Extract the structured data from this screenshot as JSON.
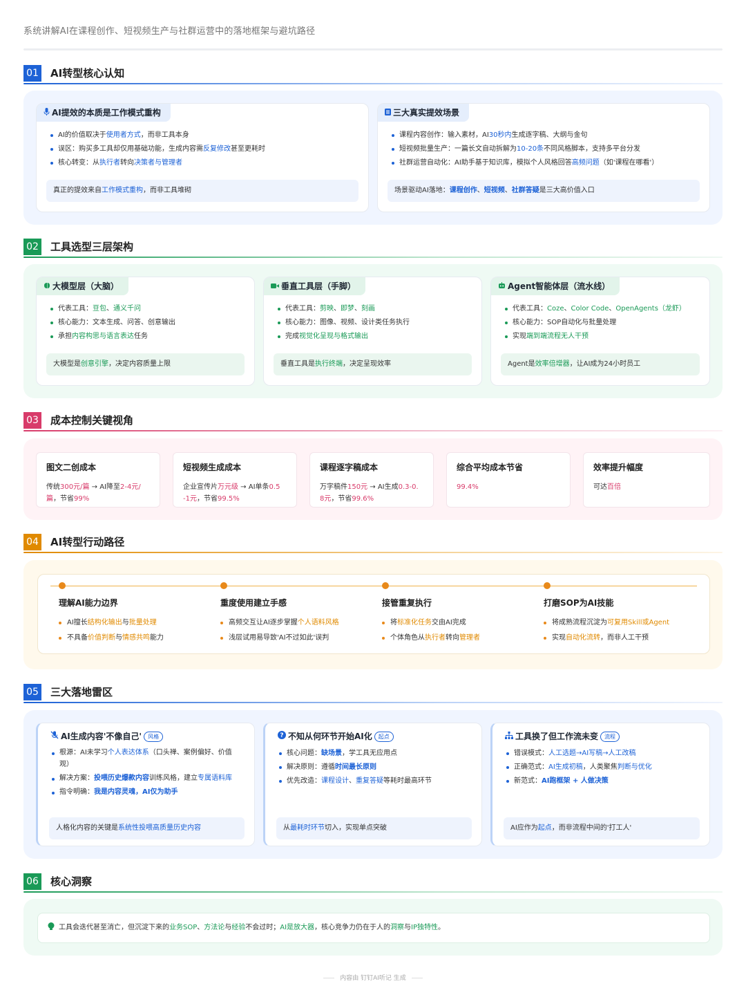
{
  "page_title": "系统讲解AI在课程创作、短视频生产与社群运营中的落地框架与避坑路径",
  "colors": {
    "blue": "#1d62d6",
    "green": "#1a9a57",
    "rose": "#d83b6a",
    "amber": "#e08a00"
  },
  "sections": {
    "s1": {
      "num": "01",
      "title": "AI转型核心认知",
      "cards": [
        {
          "icon": "microphone-icon",
          "heading": "AI提效的本质是工作模式重构",
          "points": [
            [
              {
                "t": "AI的价值取决于"
              },
              {
                "t": "使用者方式",
                "h": "blue"
              },
              {
                "t": "，而非工具本身"
              }
            ],
            [
              {
                "t": "误区：购买多工具却仅用基础功能，生成内容需"
              },
              {
                "t": "反复修改",
                "h": "blue"
              },
              {
                "t": "甚至更耗时"
              }
            ],
            [
              {
                "t": "核心转变：从"
              },
              {
                "t": "执行者",
                "h": "blue"
              },
              {
                "t": "转向"
              },
              {
                "t": "决策者与管理者",
                "h": "blue"
              }
            ]
          ],
          "note": [
            {
              "t": "真正的提效来自"
            },
            {
              "t": "工作模式重构",
              "h": "blue"
            },
            {
              "t": "，而非工具堆砌"
            }
          ]
        },
        {
          "icon": "list-icon",
          "heading": "三大真实提效场景",
          "points": [
            [
              {
                "t": "课程内容创作：输入素材，AI"
              },
              {
                "t": "30秒内",
                "h": "blue"
              },
              {
                "t": "生成逐字稿、大纲与金句"
              }
            ],
            [
              {
                "t": "短视频批量生产：一篇长文自动拆解为"
              },
              {
                "t": "10-20条",
                "h": "blue"
              },
              {
                "t": "不同风格脚本，支持多平台分发"
              }
            ],
            [
              {
                "t": "社群运营自动化：AI助手基于知识库，模拟个人风格回答"
              },
              {
                "t": "高频问题",
                "h": "blue"
              },
              {
                "t": "（如'课程在哪看'）"
              }
            ]
          ],
          "note": [
            {
              "t": "场景驱动AI落地："
            },
            {
              "t": "课程创作",
              "h": "blue",
              "b": true
            },
            {
              "t": "、"
            },
            {
              "t": "短视频",
              "h": "blue",
              "b": true
            },
            {
              "t": "、"
            },
            {
              "t": "社群答疑",
              "h": "blue",
              "b": true
            },
            {
              "t": "是三大高价值入口"
            }
          ]
        }
      ]
    },
    "s2": {
      "num": "02",
      "title": "工具选型三层架构",
      "cards": [
        {
          "icon": "brain-icon",
          "heading": "大模型层（大脑）",
          "points": [
            [
              {
                "t": "代表工具："
              },
              {
                "t": "豆包",
                "h": "green"
              },
              {
                "t": "、"
              },
              {
                "t": "通义千问",
                "h": "green"
              }
            ],
            [
              {
                "t": "核心能力：文本生成、问答、创意输出"
              }
            ],
            [
              {
                "t": "承担"
              },
              {
                "t": "内容构思与语言表达",
                "h": "green"
              },
              {
                "t": "任务"
              }
            ]
          ],
          "note": [
            {
              "t": "大模型是"
            },
            {
              "t": "创意引擎",
              "h": "green"
            },
            {
              "t": "，决定内容质量上限"
            }
          ]
        },
        {
          "icon": "video-camera-icon",
          "heading": "垂直工具层（手脚）",
          "points": [
            [
              {
                "t": "代表工具："
              },
              {
                "t": "剪映",
                "h": "green"
              },
              {
                "t": "、"
              },
              {
                "t": "即梦",
                "h": "green"
              },
              {
                "t": "、"
              },
              {
                "t": "刻画",
                "h": "green"
              }
            ],
            [
              {
                "t": "核心能力：图像、视频、设计类任务执行"
              }
            ],
            [
              {
                "t": "完成"
              },
              {
                "t": "视觉化呈现与格式输出",
                "h": "green"
              }
            ]
          ],
          "note": [
            {
              "t": "垂直工具是"
            },
            {
              "t": "执行终端",
              "h": "green"
            },
            {
              "t": "，决定呈现效率"
            }
          ]
        },
        {
          "icon": "robot-icon",
          "heading": "Agent智能体层（流水线）",
          "points": [
            [
              {
                "t": "代表工具："
              },
              {
                "t": "Coze",
                "h": "green"
              },
              {
                "t": "、"
              },
              {
                "t": "Color Code",
                "h": "green"
              },
              {
                "t": "、"
              },
              {
                "t": "OpenAgents（龙虾）",
                "h": "green"
              }
            ],
            [
              {
                "t": "核心能力：SOP自动化与批量处理"
              }
            ],
            [
              {
                "t": "实现"
              },
              {
                "t": "端到端流程无人干预",
                "h": "green"
              }
            ]
          ],
          "note": [
            {
              "t": "Agent是"
            },
            {
              "t": "效率倍增器",
              "h": "green"
            },
            {
              "t": "，让AI成为24小时员工"
            }
          ]
        }
      ]
    },
    "s3": {
      "num": "03",
      "title": "成本控制关键视角",
      "cards": [
        {
          "heading": "图文二创成本",
          "lines": [
            [
              {
                "t": "传统"
              },
              {
                "t": "300元/篇",
                "h": "rose"
              },
              {
                "t": " → AI降至"
              },
              {
                "t": "2-4元/",
                "h": "rose"
              }
            ],
            [
              {
                "t": "篇",
                "h": "rose"
              },
              {
                "t": "，节省"
              },
              {
                "t": "99%",
                "h": "rose"
              }
            ]
          ]
        },
        {
          "heading": "短视频生成成本",
          "lines": [
            [
              {
                "t": "企业宣传片"
              },
              {
                "t": "万元级",
                "h": "rose"
              },
              {
                "t": " → AI单条"
              },
              {
                "t": "0.5",
                "h": "rose"
              }
            ],
            [
              {
                "t": "-1元",
                "h": "rose"
              },
              {
                "t": "，节省"
              },
              {
                "t": "99.5%",
                "h": "rose"
              }
            ]
          ]
        },
        {
          "heading": "课程逐字稿成本",
          "lines": [
            [
              {
                "t": "万字稿件"
              },
              {
                "t": "150元",
                "h": "rose"
              },
              {
                "t": " → AI生成"
              },
              {
                "t": "0.3-0.",
                "h": "rose"
              }
            ],
            [
              {
                "t": "8元",
                "h": "rose"
              },
              {
                "t": "，节省"
              },
              {
                "t": "99.6%",
                "h": "rose"
              }
            ]
          ]
        },
        {
          "heading": "综合平均成本节省",
          "lines": [
            [
              {
                "t": "99.4%",
                "h": "rose"
              }
            ]
          ]
        },
        {
          "heading": "效率提升幅度",
          "lines": [
            [
              {
                "t": "可达"
              },
              {
                "t": "百倍",
                "h": "rose"
              }
            ]
          ]
        }
      ]
    },
    "s4": {
      "num": "04",
      "title": "AI转型行动路径",
      "steps": [
        {
          "heading": "理解AI能力边界",
          "points": [
            [
              {
                "t": "AI擅长"
              },
              {
                "t": "结构化输出",
                "h": "amber"
              },
              {
                "t": "与"
              },
              {
                "t": "批量处理",
                "h": "amber"
              }
            ],
            [
              {
                "t": "不具备"
              },
              {
                "t": "价值判断",
                "h": "amber"
              },
              {
                "t": "与"
              },
              {
                "t": "情感共鸣",
                "h": "amber"
              },
              {
                "t": "能力"
              }
            ]
          ]
        },
        {
          "heading": "重度使用建立手感",
          "points": [
            [
              {
                "t": "高频交互让AI逐步掌握"
              },
              {
                "t": "个人语料风格",
                "h": "amber"
              }
            ],
            [
              {
                "t": "浅层试用易导致'AI不过如此'误判"
              }
            ]
          ]
        },
        {
          "heading": "接管重复执行",
          "points": [
            [
              {
                "t": "将"
              },
              {
                "t": "标准化任务",
                "h": "amber"
              },
              {
                "t": "交由AI完成"
              }
            ],
            [
              {
                "t": "个体角色从"
              },
              {
                "t": "执行者",
                "h": "amber"
              },
              {
                "t": "转向"
              },
              {
                "t": "管理者",
                "h": "amber"
              }
            ]
          ]
        },
        {
          "heading": "打磨SOP为AI技能",
          "points": [
            [
              {
                "t": "将成熟流程沉淀为"
              },
              {
                "t": "可复用Skill或Agent",
                "h": "amber"
              }
            ],
            [
              {
                "t": "实现"
              },
              {
                "t": "自动化流转",
                "h": "amber"
              },
              {
                "t": "，而非人工干预"
              }
            ]
          ]
        }
      ]
    },
    "s5": {
      "num": "05",
      "title": "三大落地雷区",
      "cards": [
        {
          "icon": "mic-off-icon",
          "heading": "AI生成内容'不像自己'",
          "tag": "风格",
          "points": [
            [
              {
                "t": "根源：AI未学习"
              },
              {
                "t": "个人表达体系",
                "h": "blue"
              },
              {
                "t": "（口头禅、案例偏好、价值观）"
              }
            ],
            [
              {
                "t": "解决方案："
              },
              {
                "t": "投喂历史爆款内容",
                "h": "blue",
                "b": true
              },
              {
                "t": "训练风格，建立"
              },
              {
                "t": "专属语料库",
                "h": "blue"
              }
            ],
            [
              {
                "t": "指令明确："
              },
              {
                "t": "我是内容灵魂，AI仅为助手",
                "h": "blue",
                "b": true
              }
            ]
          ],
          "note": [
            {
              "t": "人格化内容的关键是"
            },
            {
              "t": "系统性投喂高质量历史内容",
              "h": "blue"
            }
          ]
        },
        {
          "icon": "question-circle-icon",
          "heading": "不知从何环节开始AI化",
          "tag": "起点",
          "points": [
            [
              {
                "t": "核心问题："
              },
              {
                "t": "缺场景",
                "h": "blue",
                "b": true
              },
              {
                "t": "，学工具无应用点"
              }
            ],
            [
              {
                "t": "解决原则：遵循"
              },
              {
                "t": "时间最长原则",
                "h": "blue",
                "b": true
              }
            ],
            [
              {
                "t": "优先改造："
              },
              {
                "t": "课程设计",
                "h": "blue"
              },
              {
                "t": "、"
              },
              {
                "t": "重复答疑",
                "h": "blue"
              },
              {
                "t": "等耗时最高环节"
              }
            ]
          ],
          "note": [
            {
              "t": "从"
            },
            {
              "t": "最耗时环节",
              "h": "blue"
            },
            {
              "t": "切入，实现单点突破"
            }
          ]
        },
        {
          "icon": "hierarchy-icon",
          "heading": "工具换了但工作流未变",
          "tag": "流程",
          "points": [
            [
              {
                "t": "错误模式："
              },
              {
                "t": "人工选题→AI写稿→人工改稿",
                "h": "blue"
              }
            ],
            [
              {
                "t": "正确范式："
              },
              {
                "t": "AI生成初稿",
                "h": "blue"
              },
              {
                "t": "，人类聚焦"
              },
              {
                "t": "判断与优化",
                "h": "blue"
              }
            ],
            [
              {
                "t": "新范式："
              },
              {
                "t": "AI跑框架 + 人做决策",
                "h": "blue",
                "b": true
              }
            ]
          ],
          "note": [
            {
              "t": "AI应作为"
            },
            {
              "t": "起点",
              "h": "blue"
            },
            {
              "t": "，而非流程中间的'打工人'"
            }
          ]
        }
      ]
    },
    "s6": {
      "num": "06",
      "title": "核心洞察",
      "icon": "lightbulb-icon",
      "text": [
        {
          "t": "工具会迭代甚至消亡，但沉淀下来的"
        },
        {
          "t": "业务SOP",
          "h": "green"
        },
        {
          "t": "、"
        },
        {
          "t": "方法论",
          "h": "green"
        },
        {
          "t": "与"
        },
        {
          "t": "经验",
          "h": "green"
        },
        {
          "t": "不会过时；"
        },
        {
          "t": "AI是放大器",
          "h": "green"
        },
        {
          "t": "，核心竞争力仍在于人的"
        },
        {
          "t": "洞察",
          "h": "green"
        },
        {
          "t": "与"
        },
        {
          "t": "IP独特性",
          "h": "green"
        },
        {
          "t": "。"
        }
      ]
    }
  },
  "footer": "内容由 钉钉AI听记 生成"
}
